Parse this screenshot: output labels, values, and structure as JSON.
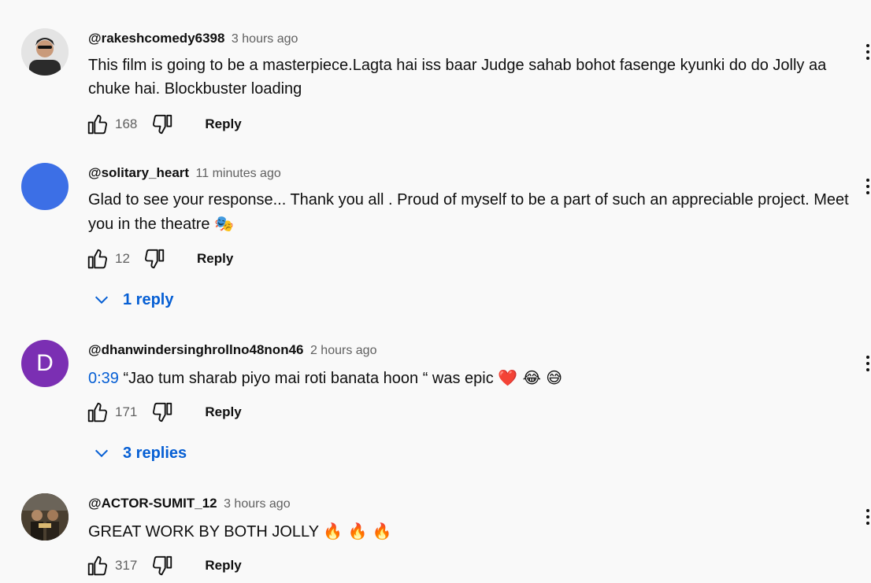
{
  "comments": [
    {
      "author": "@rakeshcomedy6398",
      "time": "3 hours ago",
      "text": "This film is going to be a masterpiece.Lagta hai iss baar Judge sahab bohot fasenge kyunki do do Jolly aa chuke hai. Blockbuster loading",
      "likes": "168",
      "reply_label": "Reply",
      "avatar_color": "#e8e8e8"
    },
    {
      "author": "@solitary_heart",
      "time": "11 minutes ago",
      "text": "Glad to see your response... Thank you all . Proud of myself to be a part of such an appreciable project. Meet you in the theatre",
      "emoji": "🎭",
      "likes": "12",
      "reply_label": "Reply",
      "replies_label": "1 reply",
      "avatar_color": "#3c6fe6"
    },
    {
      "author": "@dhanwindersinghrollno48non46",
      "time": "2 hours ago",
      "timestamp": "0:39",
      "text": " “Jao tum sharab piyo mai roti banata hoon “ was epic",
      "emoji": "❤️ 😂 😅",
      "likes": "171",
      "reply_label": "Reply",
      "replies_label": "3 replies",
      "avatar_letter": "D",
      "avatar_color": "#7b2fb3"
    },
    {
      "author": "@ACTOR-SUMIT_12",
      "time": "3 hours ago",
      "text": "GREAT WORK BY BOTH JOLLY",
      "emoji": "🔥 🔥 🔥",
      "likes": "317",
      "reply_label": "Reply",
      "avatar_color": "#3a3428"
    }
  ],
  "colors": {
    "link": "#065fd4",
    "secondary_text": "#606060",
    "background": "#f9f9f9"
  },
  "icons": [
    "like-icon",
    "dislike-icon",
    "chevron-down-icon",
    "more-vert-icon"
  ]
}
